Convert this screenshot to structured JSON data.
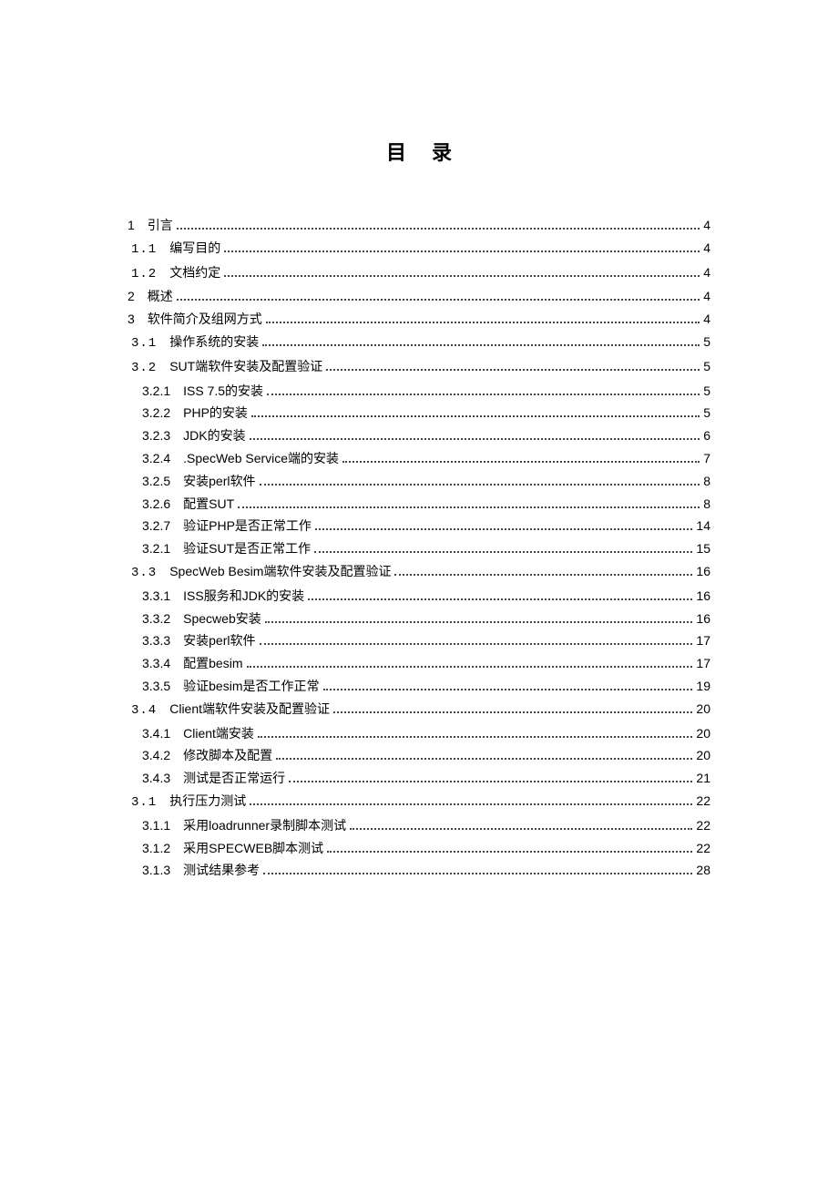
{
  "title": "目录",
  "toc": [
    {
      "num": "1",
      "label": "引言",
      "page": "4",
      "lvl": 0
    },
    {
      "num": "1.1",
      "label": "编写目的",
      "page": "4",
      "lvl": 1
    },
    {
      "num": "1.2",
      "label": "文档约定",
      "page": "4",
      "lvl": 1
    },
    {
      "num": "2",
      "label": "概述",
      "page": "4",
      "lvl": 0
    },
    {
      "num": "3",
      "label": "软件简介及组网方式",
      "page": "4",
      "lvl": 0
    },
    {
      "num": "3.1",
      "label": "操作系统的安装",
      "page": "5",
      "lvl": 1
    },
    {
      "num": "3.2",
      "label": "SUT端软件安装及配置验证",
      "page": "5",
      "lvl": 1
    },
    {
      "num": "3.2.1",
      "label": "ISS 7.5的安装",
      "page": "5",
      "lvl": 2
    },
    {
      "num": "3.2.2",
      "label": "PHP的安装",
      "page": "5",
      "lvl": 2
    },
    {
      "num": "3.2.3",
      "label": "JDK的安装",
      "page": "6",
      "lvl": 2
    },
    {
      "num": "3.2.4",
      "label": ".SpecWeb Service端的安装",
      "page": "7",
      "lvl": 2
    },
    {
      "num": "3.2.5",
      "label": "安装perl软件",
      "page": "8",
      "lvl": 2
    },
    {
      "num": "3.2.6",
      "label": "配置SUT",
      "page": "8",
      "lvl": 2
    },
    {
      "num": "3.2.7",
      "label": "验证PHP是否正常工作",
      "page": "14",
      "lvl": 2
    },
    {
      "num": "3.2.1",
      "label": "验证SUT是否正常工作",
      "page": "15",
      "lvl": 2
    },
    {
      "num": "3.3",
      "label": "SpecWeb Besim端软件安装及配置验证",
      "page": "16",
      "lvl": 1
    },
    {
      "num": "3.3.1",
      "label": "ISS服务和JDK的安装",
      "page": "16",
      "lvl": 2
    },
    {
      "num": "3.3.2",
      "label": "Specweb安装",
      "page": "16",
      "lvl": 2
    },
    {
      "num": "3.3.3",
      "label": "安装perl软件",
      "page": "17",
      "lvl": 2
    },
    {
      "num": "3.3.4",
      "label": "配置besim",
      "page": "17",
      "lvl": 2
    },
    {
      "num": "3.3.5",
      "label": "验证besim是否工作正常",
      "page": "19",
      "lvl": 2
    },
    {
      "num": "3.4",
      "label": "Client端软件安装及配置验证",
      "page": "20",
      "lvl": 1
    },
    {
      "num": "3.4.1",
      "label": "Client端安装",
      "page": "20",
      "lvl": 2
    },
    {
      "num": "3.4.2",
      "label": "修改脚本及配置",
      "page": "20",
      "lvl": 2
    },
    {
      "num": "3.4.3",
      "label": "测试是否正常运行",
      "page": "21",
      "lvl": 2
    },
    {
      "num": "3.1",
      "label": "执行压力测试",
      "page": "22",
      "lvl": 1
    },
    {
      "num": "3.1.1",
      "label": "采用loadrunner录制脚本测试",
      "page": "22",
      "lvl": 2
    },
    {
      "num": "3.1.2",
      "label": "采用SPECWEB脚本测试",
      "page": "22",
      "lvl": 2
    },
    {
      "num": "3.1.3",
      "label": "测试结果参考",
      "page": "28",
      "lvl": 2
    }
  ]
}
